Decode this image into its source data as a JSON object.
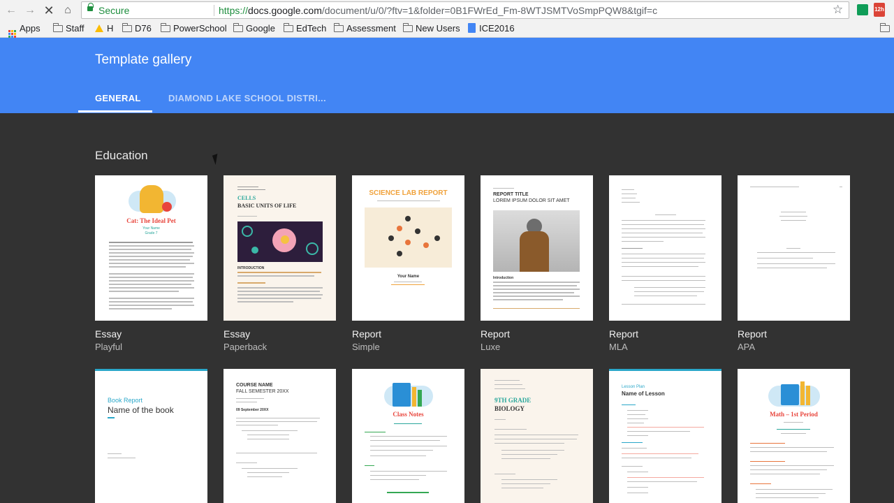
{
  "browser": {
    "secure_label": "Secure",
    "url_protocol": "https://",
    "url_host": "docs.google.com",
    "url_path": "/document/u/0/?ftv=1&folder=0B1FWrEd_Fm-8WTJSMTVoSmpPQW8&tgif=c",
    "badge_text": "12h",
    "bookmarks": [
      "Apps",
      "Staff",
      "H",
      "D76",
      "PowerSchool",
      "Google",
      "EdTech",
      "Assessment",
      "New Users",
      "ICE2016"
    ]
  },
  "header": {
    "title": "Template gallery",
    "tabs": [
      {
        "label": "GENERAL"
      },
      {
        "label": "DIAMOND LAKE SCHOOL DISTRI..."
      }
    ]
  },
  "section": {
    "title": "Education"
  },
  "templates": [
    {
      "title": "Essay",
      "subtitle": "Playful",
      "heading": "Cat: The Ideal Pet",
      "author": "Your Name",
      "grade": "Grade 7"
    },
    {
      "title": "Essay",
      "subtitle": "Paperback",
      "heading_small": "CELLS",
      "heading": "BASIC UNITS OF LIFE",
      "section": "INTRODUCTION"
    },
    {
      "title": "Report",
      "subtitle": "Simple",
      "heading": "SCIENCE LAB REPORT",
      "author": "Your Name"
    },
    {
      "title": "Report",
      "subtitle": "Luxe",
      "heading_small": "REPORT TITLE",
      "heading": "LOREM IPSUM DOLOR SIT AMET",
      "section": "Introduction"
    },
    {
      "title": "Report",
      "subtitle": "MLA"
    },
    {
      "title": "Report",
      "subtitle": "APA"
    }
  ],
  "templates_row2": [
    {
      "heading_small": "Book Report",
      "heading": "Name of the book"
    },
    {
      "heading_small": "COURSE NAME",
      "heading": "FALL SEMESTER 20XX",
      "section": "09 September 20XX"
    },
    {
      "heading": "Class Notes"
    },
    {
      "heading_small": "9TH GRADE",
      "heading": "BIOLOGY"
    },
    {
      "heading_small": "Lesson Plan",
      "heading": "Name of Lesson"
    },
    {
      "heading": "Math – 1st Period"
    }
  ],
  "colors": {
    "brand_blue": "#4285f4",
    "background": "#323232",
    "secure_green": "#1e8e3e",
    "accent_red": "#e8453c",
    "accent_teal": "#2aa79b"
  }
}
